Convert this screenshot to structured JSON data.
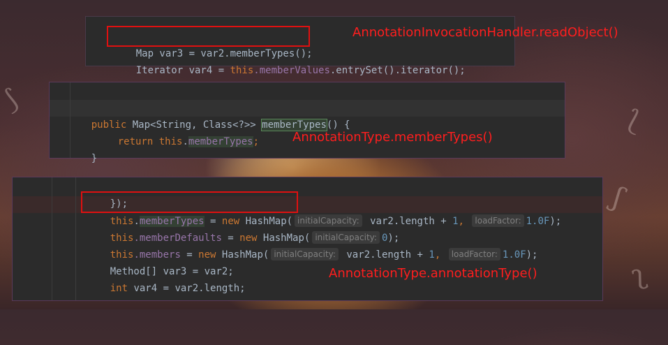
{
  "captions": {
    "read_object": "AnnotationInvocationHandler.readObject()",
    "member_types": "AnnotationType.memberTypes()",
    "annotation_type": "AnnotationType.annotationType()"
  },
  "panel1": {
    "line1": "Map var3 = var2.memberTypes();",
    "line2_prefix": "Iterator var4 = ",
    "line2_this": "this",
    "line2_field": ".memberValues",
    "line2_rest": ".entrySet().iterator();"
  },
  "panel2": {
    "public": "public",
    "sig_type": " Map<String, Class<?>> ",
    "method_name": "memberTypes",
    "sig_end": "() {",
    "return_kw": "return",
    "this_kw": "this",
    "dot": ".",
    "field": "memberTypes",
    "semicolon": ";",
    "close_brace": "}"
  },
  "panel3": {
    "top_line": "});",
    "l1_this": "this",
    "l1_dot": ".",
    "l1_field": "memberTypes",
    "l1_eq": " = ",
    "l1_new": "new",
    "l1_cls": " HashMap(",
    "l1_hint1": "initialCapacity:",
    "l1_arg1": " var2.length + ",
    "l1_num1": "1",
    "l1_comma": ", ",
    "l1_hint2": "loadFactor:",
    "l1_num2": "1.0F",
    "l1_end": ");",
    "l2_this": "this",
    "l2_field": ".memberDefaults",
    "l2_eq": " = ",
    "l2_new": "new",
    "l2_cls": " HashMap(",
    "l2_hint1": "initialCapacity:",
    "l2_num1": "0",
    "l2_end": ");",
    "l3_this": "this",
    "l3_field": ".members",
    "l3_eq": " = ",
    "l3_new": "new",
    "l3_cls": " HashMap(",
    "l3_hint1": "initialCapacity:",
    "l3_arg1": " var2.length + ",
    "l3_num1": "1",
    "l3_comma": ", ",
    "l3_hint2": "loadFactor:",
    "l3_num2": "1.0F",
    "l3_end": ");",
    "l4": "Method[] var3 = var2;",
    "l5_int": "int",
    "l5_rest": " var4 = var2.length;"
  }
}
